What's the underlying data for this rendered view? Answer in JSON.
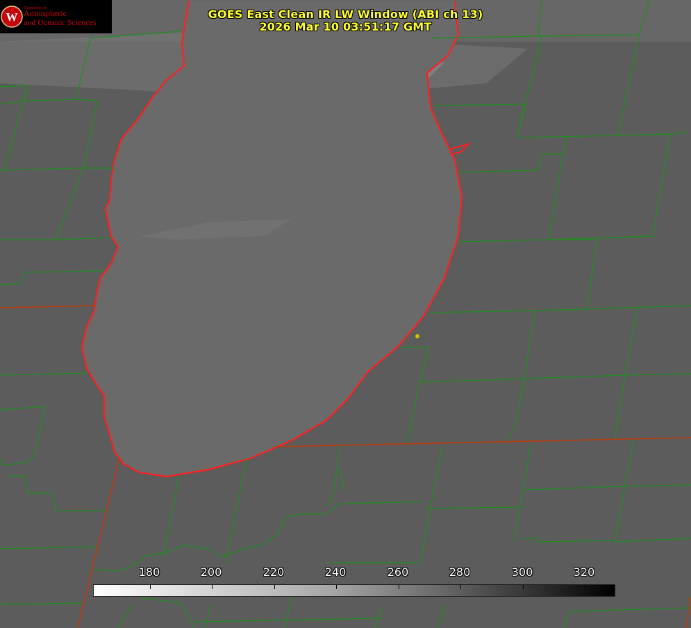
{
  "title_line1": "GOES East Clean IR LW Window (ABI ch 13)",
  "title_line2": "2026 Mar 10 03:51:17 GMT",
  "logo": {
    "dept": "Department of",
    "line1": "Atmospheric",
    "line2": "and Oceanic Sciences",
    "shield_letter": "W"
  },
  "colorbar": {
    "ticks": [
      "180",
      "200",
      "220",
      "240",
      "260",
      "280",
      "300",
      "320"
    ]
  },
  "colors": {
    "title": "#ffff33",
    "county_lines": "#1f8f1f",
    "state_lines": "#c0390b",
    "coastline": "#ff2020",
    "background": "#5a5a5a",
    "lake": "#6b6b6b",
    "marker": "#d4c000"
  }
}
